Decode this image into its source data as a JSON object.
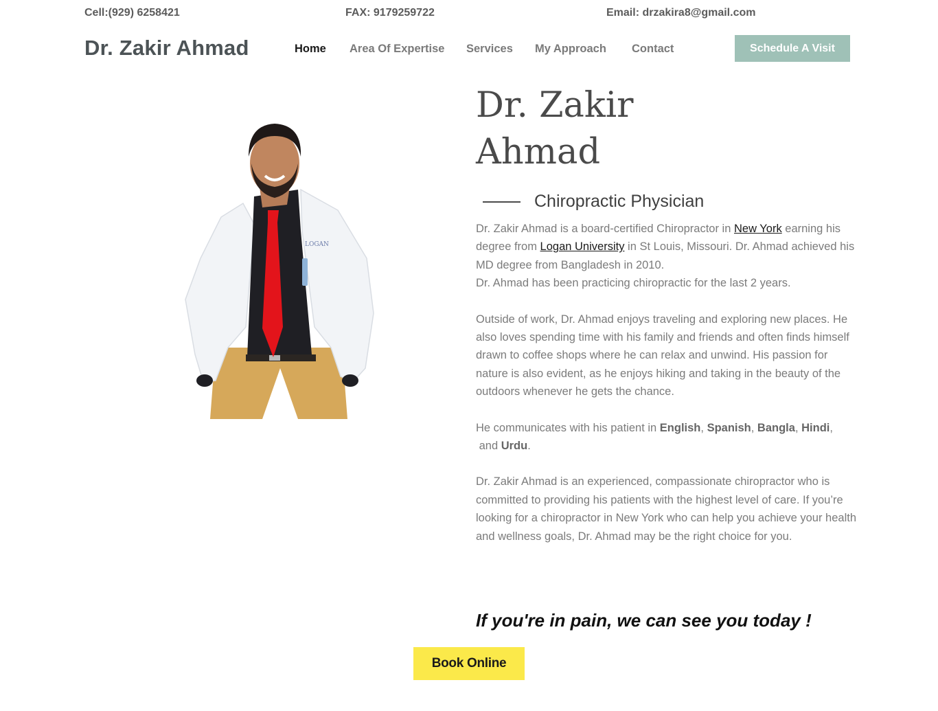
{
  "topbar": {
    "cell": "Cell:(929) 6258421",
    "fax": "FAX: 9179259722",
    "email": "Email: drzakira8@gmail.com"
  },
  "header": {
    "brand": "Dr. Zakir Ahmad",
    "nav": [
      {
        "label": "Home",
        "active": true
      },
      {
        "label": "Area Of Expertise",
        "active": false
      },
      {
        "label": "Services",
        "active": false
      },
      {
        "label": "My Approach",
        "active": false
      },
      {
        "label": "Contact",
        "active": false
      }
    ],
    "cta": "Schedule A Visit"
  },
  "hero": {
    "title_line1": "Dr. Zakir",
    "title_line2": "Ahmad",
    "subtitle": "Chiropractic Physician"
  },
  "bio": {
    "p1_a": "Dr. Zakir Ahmad is a board-certified Chiropractor in ",
    "p1_link1": "New York",
    "p1_b": " earning his degree from ",
    "p1_link2": "Logan University",
    "p1_c": " in St Louis, Missouri. Dr. Ahmad achieved his MD degree from Bangladesh in 2010.",
    "p1_d": "Dr. Ahmad has been practicing chiropractic for the last 2 years.",
    "p2": "Outside of work, Dr. Ahmad enjoys traveling and exploring new places. He also loves spending time with his family and friends and often finds himself drawn to coffee shops where he can relax and unwind. His passion for nature is also evident, as he enjoys hiking and taking in the beauty of the outdoors whenever he gets the chance.",
    "p3_a": "He communicates with his patient in ",
    "lang1": "English",
    "lang2": "Spanish",
    "lang3": "Bangla",
    "lang4": "Hindi",
    "p3_and": "and ",
    "lang5": "Urdu",
    "p4": "Dr. Zakir Ahmad is an experienced, compassionate chiropractor who is committed to providing his patients with the highest level of care. If you’re looking for a chiropractor in New York who can help you achieve your health and wellness goals, Dr. Ahmad may be the right choice for you."
  },
  "tagline": "If you're in pain, we can see you today !",
  "book_button": "Book Online",
  "colors": {
    "cta_bg": "#9fc1b7",
    "book_bg": "#fbe94a",
    "tie": "#e3141b",
    "coat": "#f2f4f7",
    "pants": "#d6a85a"
  }
}
